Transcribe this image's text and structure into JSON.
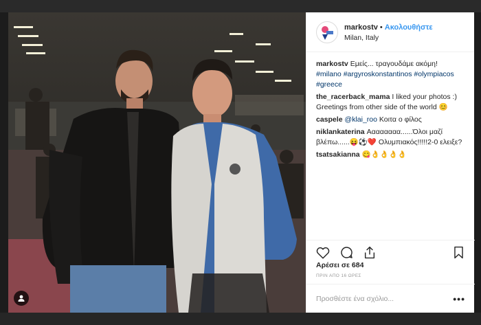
{
  "post": {
    "username": "markostv",
    "follow_label": "Ακολουθήστε",
    "location": "Milan, Italy",
    "likes_label": "Αρέσει σε 684",
    "time_label": "ΠΡΙΝ ΑΠΟ 16 ΩΡΕΣ",
    "add_comment_placeholder": "Προσθέστε ένα σχόλιο...",
    "more_label": "•••"
  },
  "caption": {
    "user": "markostv",
    "text": "Εμείς... τραγουδάμε ακόμη!",
    "hashtags": "#milano #argyroskonstantinos #olympiacos #greece"
  },
  "comments": [
    {
      "user": "the_racerback_mama",
      "text": "I liked your photos :) Greetings from other side of the world 😊"
    },
    {
      "user": "caspele",
      "mention": "@klai_roo",
      "text": " Κοιτα ο φίλος"
    },
    {
      "user": "niklankaterina",
      "text": "Αααααααα......Όλοι μαζί βλέπω......😝⚽❤️ Ολυμπιακός!!!!!2-0 ελειξε?"
    },
    {
      "user": "tsatsakianna",
      "text": "😋👌👌👌👌"
    }
  ],
  "colors": {
    "link": "#3897f0",
    "hashtag": "#003569",
    "text": "#262626",
    "muted": "#999999"
  },
  "icons": [
    "heart-icon",
    "comment-icon",
    "share-icon",
    "bookmark-icon",
    "tag-person-icon"
  ]
}
